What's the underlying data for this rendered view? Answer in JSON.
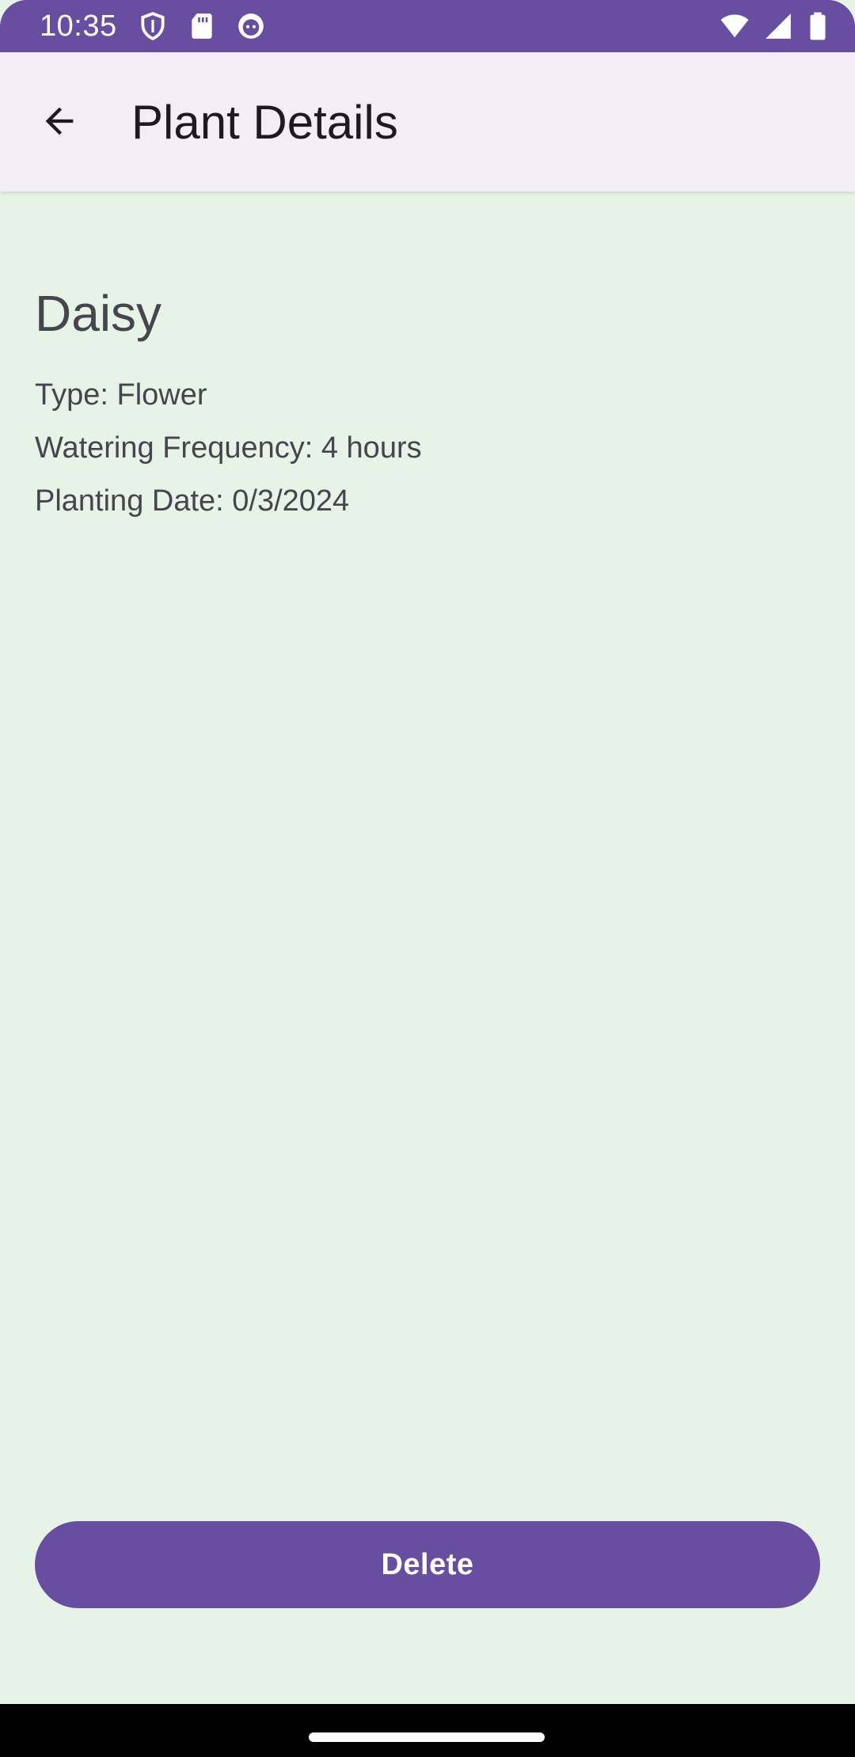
{
  "status_bar": {
    "time": "10:35",
    "left_icons": [
      "shield-icon",
      "sd-card-icon",
      "face-icon"
    ],
    "right_icons": [
      "wifi-icon",
      "signal-icon",
      "battery-icon"
    ],
    "color": "#674ea1"
  },
  "app_bar": {
    "title": "Plant Details",
    "back_icon": "arrow-back-icon"
  },
  "plant": {
    "name": "Daisy",
    "type_text": "Type: Flower",
    "watering_text": "Watering Frequency: 4 hours",
    "planting_date_text": "Planting Date: 0/3/2024"
  },
  "actions": {
    "delete_label": "Delete"
  },
  "colors": {
    "primary": "#674ea1",
    "background": "#e8f3e8",
    "app_bar_bg": "#f2edf7"
  }
}
